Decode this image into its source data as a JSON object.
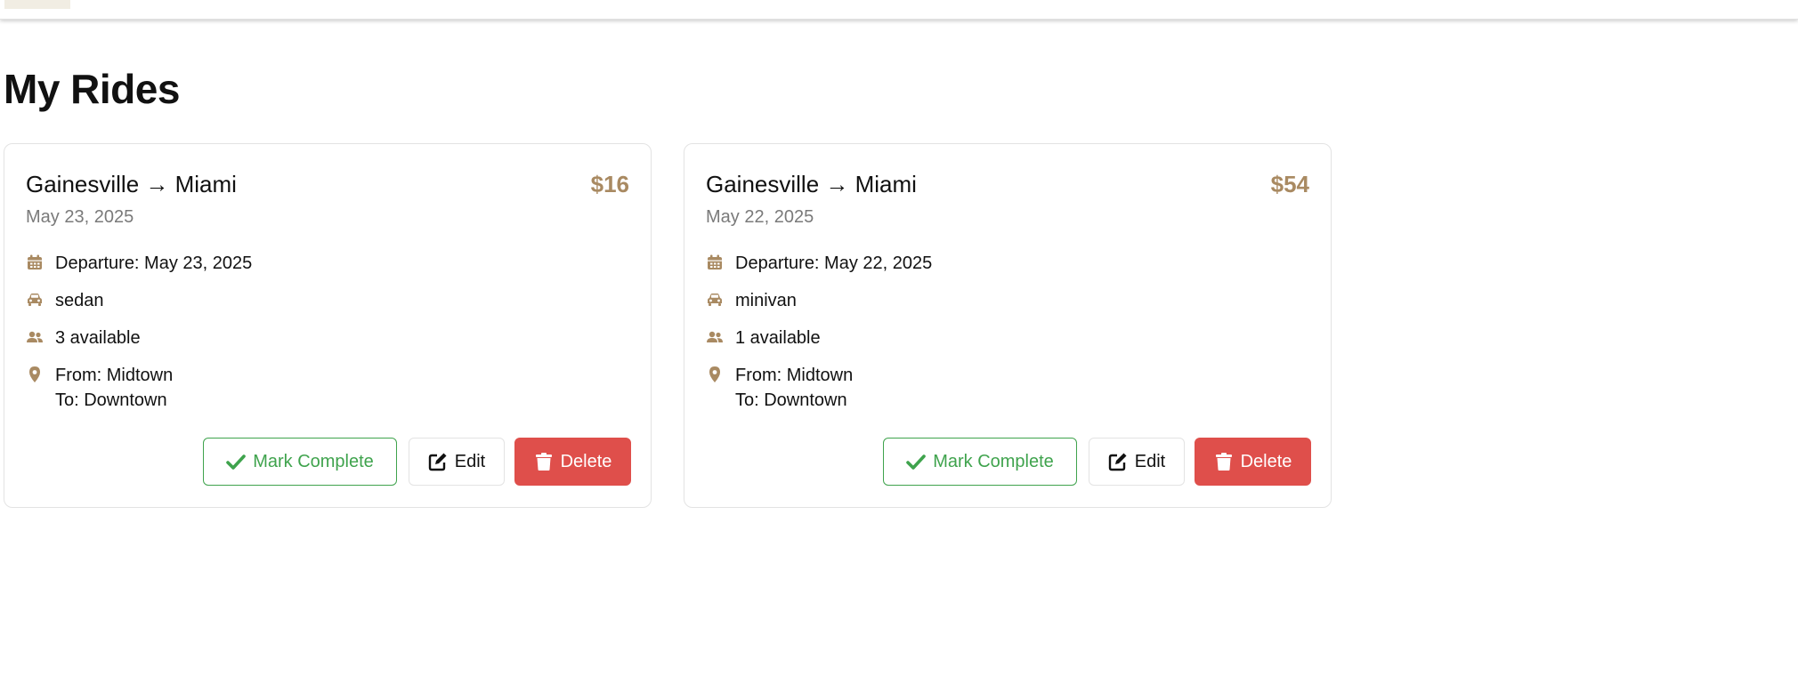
{
  "page": {
    "title": "My Rides"
  },
  "colors": {
    "accent": "#a98a62",
    "success": "#3fa34d",
    "danger": "#df4f4b"
  },
  "rides": [
    {
      "route": "Gainesville → Miami",
      "price": "$16",
      "date": "May 23, 2025",
      "departure": "Departure: May 23, 2025",
      "vehicle": "sedan",
      "seats": "3 available",
      "from": "From: Midtown",
      "to": "To: Downtown",
      "actions": {
        "complete": "Mark Complete",
        "edit": "Edit",
        "delete": "Delete"
      }
    },
    {
      "route": "Gainesville → Miami",
      "price": "$54",
      "date": "May 22, 2025",
      "departure": "Departure: May 22, 2025",
      "vehicle": "minivan",
      "seats": "1 available",
      "from": "From: Midtown",
      "to": "To: Downtown",
      "actions": {
        "complete": "Mark Complete",
        "edit": "Edit",
        "delete": "Delete"
      }
    }
  ],
  "icons": [
    "calendar-icon",
    "car-icon",
    "users-icon",
    "map-pin-icon",
    "check-icon",
    "edit-icon",
    "trash-icon"
  ]
}
